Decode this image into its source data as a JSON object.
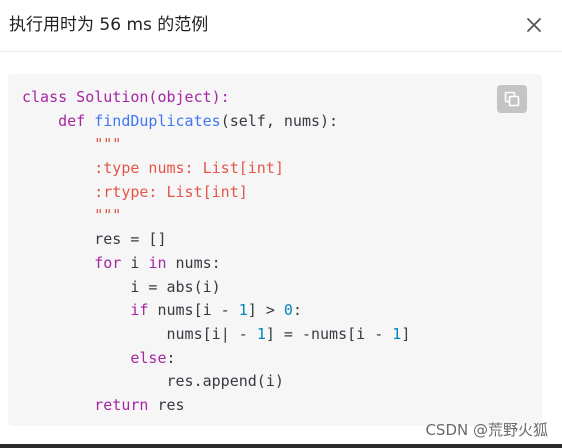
{
  "dialog": {
    "title": "执行用时为 56 ms 的范例",
    "close_icon": "close-icon",
    "copy_icon": "copy-icon"
  },
  "code": {
    "language": "python",
    "lines": [
      {
        "indent": "",
        "tokens": [
          {
            "t": "class Solution(object):",
            "c": "kw-class"
          }
        ]
      },
      {
        "indent": "    ",
        "tokens": [
          {
            "t": "def ",
            "c": "kw"
          },
          {
            "t": "findDuplicates",
            "c": "fn"
          },
          {
            "t": "(self, nums):",
            "c": "plain"
          }
        ]
      },
      {
        "indent": "        ",
        "tokens": [
          {
            "t": "\"\"\"",
            "c": "str"
          }
        ]
      },
      {
        "indent": "        ",
        "tokens": [
          {
            "t": ":type nums: List[int]",
            "c": "str"
          }
        ]
      },
      {
        "indent": "        ",
        "tokens": [
          {
            "t": ":rtype: List[int]",
            "c": "str"
          }
        ]
      },
      {
        "indent": "        ",
        "tokens": [
          {
            "t": "\"\"\"",
            "c": "str"
          }
        ]
      },
      {
        "indent": "        ",
        "tokens": [
          {
            "t": "res = []",
            "c": "plain"
          }
        ]
      },
      {
        "indent": "        ",
        "tokens": [
          {
            "t": "for",
            "c": "kw"
          },
          {
            "t": " i ",
            "c": "plain"
          },
          {
            "t": "in",
            "c": "kw"
          },
          {
            "t": " nums:",
            "c": "plain"
          }
        ]
      },
      {
        "indent": "            ",
        "tokens": [
          {
            "t": "i = abs(i)",
            "c": "plain"
          }
        ]
      },
      {
        "indent": "            ",
        "tokens": [
          {
            "t": "if",
            "c": "kw"
          },
          {
            "t": " nums[i - ",
            "c": "plain"
          },
          {
            "t": "1",
            "c": "num"
          },
          {
            "t": "] > ",
            "c": "plain"
          },
          {
            "t": "0",
            "c": "num"
          },
          {
            "t": ":",
            "c": "plain"
          }
        ]
      },
      {
        "indent": "                ",
        "tokens": [
          {
            "t": "nums[i",
            "c": "plain"
          },
          {
            "t": "| - ",
            "c": "plain"
          },
          {
            "t": "1",
            "c": "num"
          },
          {
            "t": "] = -nums[i - ",
            "c": "plain"
          },
          {
            "t": "1",
            "c": "num"
          },
          {
            "t": "]",
            "c": "plain"
          }
        ]
      },
      {
        "indent": "            ",
        "tokens": [
          {
            "t": "else",
            "c": "kw"
          },
          {
            "t": ":",
            "c": "plain"
          }
        ]
      },
      {
        "indent": "                ",
        "tokens": [
          {
            "t": "res.append(i)",
            "c": "plain"
          }
        ]
      },
      {
        "indent": "        ",
        "tokens": [
          {
            "t": "return",
            "c": "kw"
          },
          {
            "t": " res",
            "c": "plain"
          }
        ]
      }
    ]
  },
  "watermark": "CSDN @荒野火狐",
  "colors": {
    "keyword": "#a626a4",
    "function": "#4078f2",
    "string": "#e45649",
    "number": "#0184bc",
    "text": "#383a42",
    "code_background": "#f6f6f6"
  }
}
